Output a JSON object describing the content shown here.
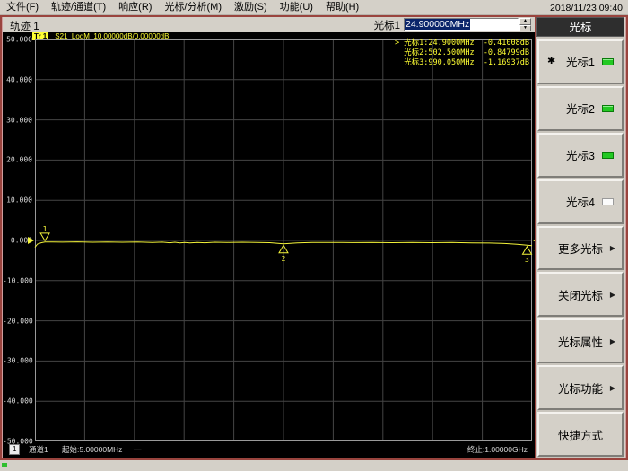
{
  "window": {
    "date": "2018/11/23 09:40"
  },
  "menu": {
    "items": [
      "文件(F)",
      "轨迹/通道(T)",
      "响应(R)",
      "光标/分析(M)",
      "激励(S)",
      "功能(U)",
      "帮助(H)"
    ]
  },
  "toolbar": {
    "trace_label": "轨迹 1",
    "marker_label": "光标1",
    "marker_value": "24.900000MHz"
  },
  "trace_info": {
    "badge": "Tr 1",
    "text": "S21  LogM  10.00000dB/0.00000dB"
  },
  "marker_readout": {
    "lines": [
      {
        "prefix": ">",
        "label": "光标1:",
        "freq": "24.9000MHz",
        "value": "-0.41008dB"
      },
      {
        "prefix": "",
        "label": "光标2:",
        "freq": "502.500MHz",
        "value": "-0.84799dB"
      },
      {
        "prefix": "",
        "label": "光标3:",
        "freq": "990.050MHz",
        "value": "-1.16937dB"
      }
    ]
  },
  "sidebar": {
    "title": "光标",
    "buttons": [
      {
        "label": "光标1",
        "star": true,
        "led": "on"
      },
      {
        "label": "光标2",
        "led": "on"
      },
      {
        "label": "光标3",
        "led": "on"
      },
      {
        "label": "光标4",
        "led": "off"
      },
      {
        "label": "更多光标",
        "arrow": true
      },
      {
        "label": "关闭光标",
        "arrow": true
      },
      {
        "label": "光标属性",
        "arrow": true
      },
      {
        "label": "光标功能",
        "arrow": true
      },
      {
        "label": "快捷方式"
      }
    ]
  },
  "channel_bar": {
    "badge": "1",
    "channel": "通道1",
    "start": "起始:5.00000MHz",
    "indicator": "—",
    "stop": "终止:1.00000GHz"
  },
  "colors": {
    "trace": "#f4f43a",
    "readout": "#ffff33",
    "grid": "#454545",
    "grid_border": "#9a9a9a",
    "selection_bg": "#0a246a",
    "led_on": "#23c923",
    "frame_red": "#9a443e"
  },
  "chart_data": {
    "type": "line",
    "title": "S21 LogM 10.00000dB/0.00000dB",
    "xlabel": "频率 5.00000MHz - 1.00000GHz",
    "ylabel": "dB",
    "xlim": [
      5,
      1000
    ],
    "ylim": [
      -50,
      50
    ],
    "x_divisions": 10,
    "y_divisions": 10,
    "reference_level": 0,
    "y_tick_labels": [
      "50.000",
      "40.000",
      "30.000",
      "20.000",
      "10.000",
      "0.000",
      "-10.000",
      "-20.000",
      "-30.000",
      "-40.000",
      "-50.000"
    ],
    "series": [
      {
        "name": "S21",
        "x": [
          5,
          10,
          18,
          24.9,
          40,
          60,
          90,
          120,
          150,
          180,
          210,
          240,
          260,
          275,
          285,
          295,
          305,
          315,
          330,
          345,
          365,
          390,
          420,
          450,
          475,
          502.5,
          530,
          560,
          600,
          640,
          680,
          720,
          760,
          800,
          840,
          880,
          915,
          945,
          970,
          990.05,
          1000
        ],
        "y": [
          -1.7,
          -0.9,
          -0.55,
          -0.41,
          -0.38,
          -0.42,
          -0.36,
          -0.44,
          -0.38,
          -0.45,
          -0.4,
          -0.52,
          -0.42,
          -0.58,
          -0.45,
          -0.62,
          -0.48,
          -0.6,
          -0.5,
          -0.58,
          -0.44,
          -0.5,
          -0.44,
          -0.5,
          -0.55,
          -0.85,
          -0.6,
          -0.52,
          -0.48,
          -0.54,
          -0.5,
          -0.55,
          -0.5,
          -0.56,
          -0.52,
          -0.6,
          -0.65,
          -0.75,
          -0.95,
          -1.17,
          -1.28
        ]
      }
    ],
    "markers": [
      {
        "n": "1",
        "freq_mhz": 24.9,
        "value_db": -0.41008,
        "active": true
      },
      {
        "n": "2",
        "freq_mhz": 502.5,
        "value_db": -0.84799,
        "active": false
      },
      {
        "n": "3",
        "freq_mhz": 990.05,
        "value_db": -1.16937,
        "active": false
      }
    ]
  }
}
